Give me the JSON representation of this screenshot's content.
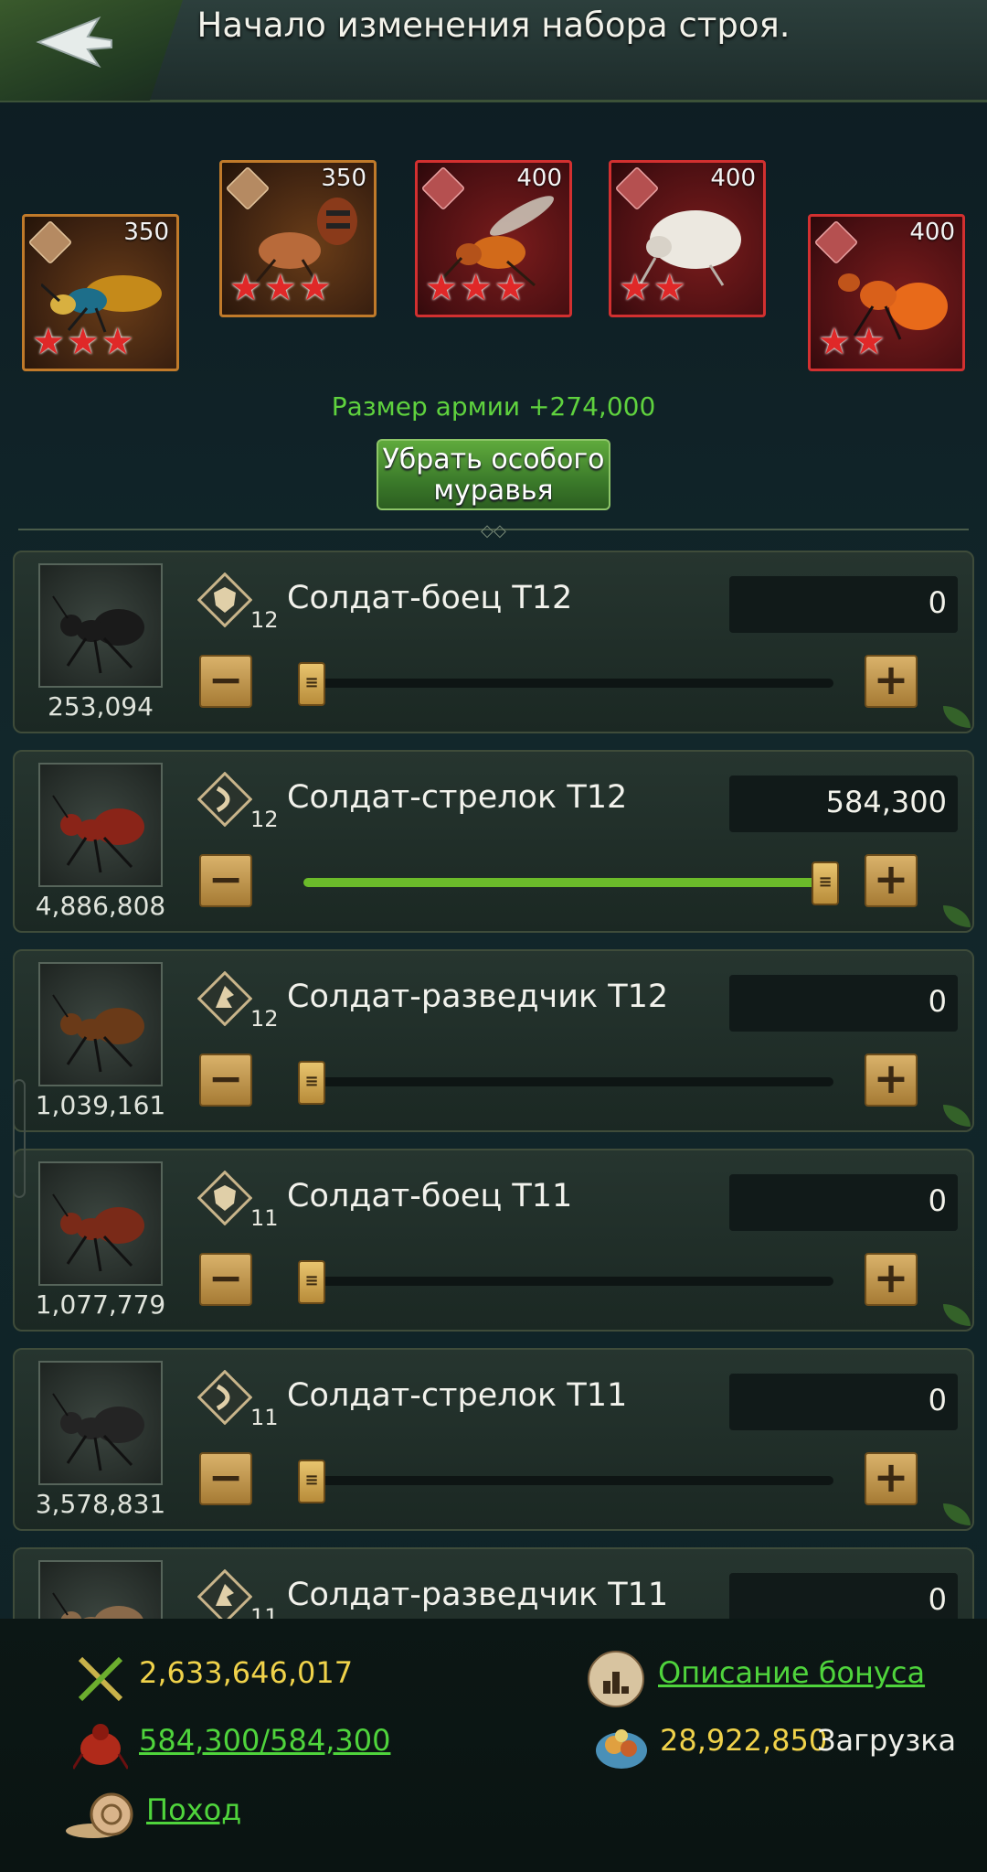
{
  "header": {
    "title": "Начало изменения набора строя."
  },
  "special_ants": [
    {
      "power": "350",
      "stars": "★★★",
      "color": "orange"
    },
    {
      "power": "350",
      "stars": "★★★",
      "color": "orange"
    },
    {
      "power": "400",
      "stars": "★★★",
      "color": "red"
    },
    {
      "power": "400",
      "stars": "★★",
      "color": "red"
    },
    {
      "power": "400",
      "stars": "★★",
      "color": "red"
    }
  ],
  "army_size": "Размер армии +274,000",
  "remove_button": "Убрать особого муравья",
  "troops": [
    {
      "name": "Солдат-боец T12",
      "tier": "12",
      "count": "253,094",
      "value": "0",
      "fill": 0.0,
      "badge": "shield"
    },
    {
      "name": "Солдат-стрелок T12",
      "tier": "12",
      "count": "4,886,808",
      "value": "584,300",
      "fill": 1.0,
      "badge": "bow"
    },
    {
      "name": "Солдат-разведчик T12",
      "tier": "12",
      "count": "1,039,161",
      "value": "0",
      "fill": 0.0,
      "badge": "wing"
    },
    {
      "name": "Солдат-боец T11",
      "tier": "11",
      "count": "1,077,779",
      "value": "0",
      "fill": 0.0,
      "badge": "shield"
    },
    {
      "name": "Солдат-стрелок T11",
      "tier": "11",
      "count": "3,578,831",
      "value": "0",
      "fill": 0.0,
      "badge": "bow"
    },
    {
      "name": "Солдат-разведчик T11",
      "tier": "11",
      "count": "",
      "value": "0",
      "fill": 0.0,
      "badge": "wing"
    }
  ],
  "bottom": {
    "power": "2,633,646,017",
    "troops_used": "584,300/584,300",
    "march_link": "Поход",
    "bonus_link": "Описание бонуса",
    "load_value": "28,922,850",
    "load_label": "Загрузка"
  },
  "colors": {
    "accent_green": "#5fd23e",
    "gold": "#f0d24a",
    "red_card": "#d23030",
    "orange_card": "#c07a2a"
  }
}
